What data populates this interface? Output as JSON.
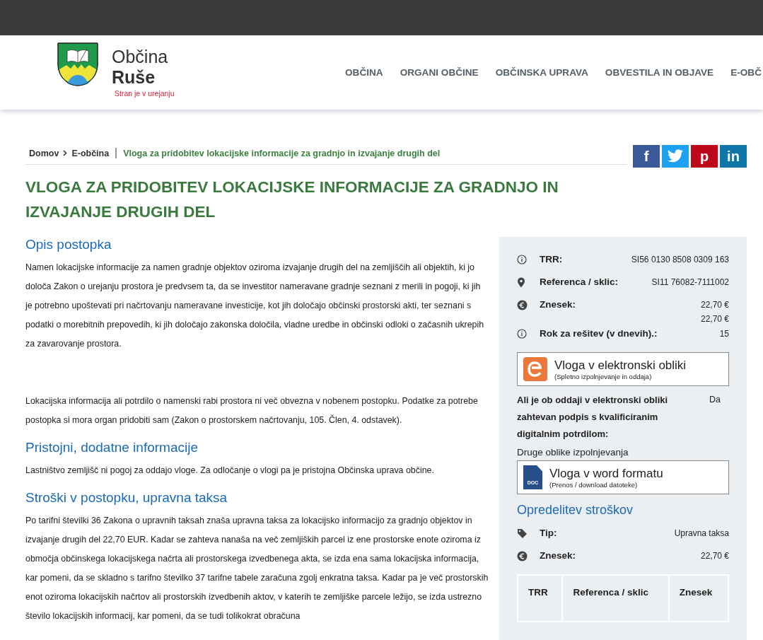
{
  "header": {
    "logo_title": "Občina",
    "logo_subtitle": "Ruše",
    "notice": "Stran je v urejanju",
    "nav": [
      {
        "label": "OBČINA"
      },
      {
        "label": "ORGANI OBČINE"
      },
      {
        "label": "OBČINSKA UPRAVA"
      },
      {
        "label": "OBVESTILA IN OBJAVE"
      },
      {
        "label": "E-OBČ"
      }
    ]
  },
  "breadcrumb": [
    {
      "label": "Domov",
      "current": false
    },
    {
      "label": "E-občina",
      "current": false
    },
    {
      "label": "Vloga za pridobitev lokacijske informacije za gradnjo in izvajanje drugih del",
      "current": true
    }
  ],
  "share": [
    {
      "kind": "facebook",
      "glyph": "f"
    },
    {
      "kind": "twitter"
    },
    {
      "kind": "pinterest",
      "glyph": "p"
    },
    {
      "kind": "linkedin",
      "glyph": "in"
    }
  ],
  "title": "VLOGA ZA PRIDOBITEV LOKACIJSKE INFORMACIJE ZA GRADNJO IN IZVAJANJE DRUGIH DEL",
  "sections": [
    {
      "heading": "Opis postopka",
      "paragraphs": [
        "Namen lokacijske informacije za namen gradnje objektov oziroma izvajanje drugih del na zemljiščih ali objektih, ki jo določa Zakon o urejanju prostora je predvsem ta, da se investitor nameravane gradnje seznani z merili in pogoji, ki jih je potrebno upoštevati pri načrtovanju nameravane investicije, kot jih določajo občinski prostorski akti, ter seznani s podatki o morebitnih prepovedih, ki jih določajo zakonska določila, vladne uredbe in občinski odloki o začasnih ukrepih za zavarovanje prostora.",
        "Lokacijska informacija ali potrdilo o namenski rabi prostora ni več obvezna v nobenem postopku. Podatke za potrebe postopka si mora organ pridobiti sam (Zakon o prostorskem načrtovanju, 105. Člen, 4. odstavek)."
      ]
    },
    {
      "heading": "Pristojni, dodatne informacije",
      "paragraphs": [
        "Lastništvo zemljišč ni pogoj za oddajo vloge. Za odločanje o vlogi pa je pristojna Občinska uprava občine."
      ]
    },
    {
      "heading": "Stroški v postopku, upravna taksa",
      "paragraphs": [
        "Po tarifni številki 36 Zakona o upravnih taksah znaša upravna taksa za lokacijsko informacijo za gradnjo objektov in izvajanje drugih del 22,70 EUR. Kadar se zahteva nanaša na več zemljiških parcel iz ene prostorske enote oziroma iz območja občinskega lokacijskega načrta ali prostorskega izvedbenega akta, se izda ena sama lokacijska informacija, kar pomeni, da se skladno s tarifno številko 37 tarifne tabele zaračuna zgolj enkratna taksa. Kadar pa je več prostorskih enot oziroma lokacijskih načrtov ali prostorskih izvedbenih aktov, v katerih te zemljiške parcele ležijo, se izda ustrezno število lokacijskih informacij, kar pomeni, da se tudi tolikokrat obračuna"
      ]
    }
  ],
  "sidebar": {
    "details": [
      {
        "kind": "info",
        "label": "TRR:",
        "values": [
          "SI56 0130 8508 0309 163"
        ]
      },
      {
        "kind": "pin",
        "label": "Referenca / sklic:",
        "values": [
          "SI11 76082-7111002"
        ]
      },
      {
        "kind": "euro",
        "label": "Znesek:",
        "values": [
          "22,70 €",
          "22,70 €"
        ]
      },
      {
        "kind": "info",
        "label": "Rok za rešitev (v dnevih).:",
        "values": [
          "15"
        ]
      }
    ],
    "eform": {
      "kind": "eform",
      "title": "Vloga v elektronski obliki",
      "subtitle": "(Spletno izpolnjevanje in oddaja)"
    },
    "signature": {
      "question": "Ali je ob oddaji v elektronski obliki zahtevan podpis s kvalificiranim digitalnim potrdilom:",
      "answer": "Da"
    },
    "other_forms_label": "Druge oblike izpolnjevanja",
    "word_form": {
      "kind": "doc",
      "icon_label": "DOC",
      "title": "Vloga v word formatu",
      "subtitle": "(Prenos / download datoteke)"
    },
    "costs_heading": "Opredelitev stroškov",
    "costs": [
      {
        "kind": "tag",
        "label": "Tip:",
        "value": "Upravna taksa"
      },
      {
        "kind": "euro",
        "label": "Znesek:",
        "value": "22,70 €"
      }
    ],
    "table": {
      "columns": [
        "TRR",
        "Referenca / sklic",
        "Znesek"
      ]
    }
  }
}
